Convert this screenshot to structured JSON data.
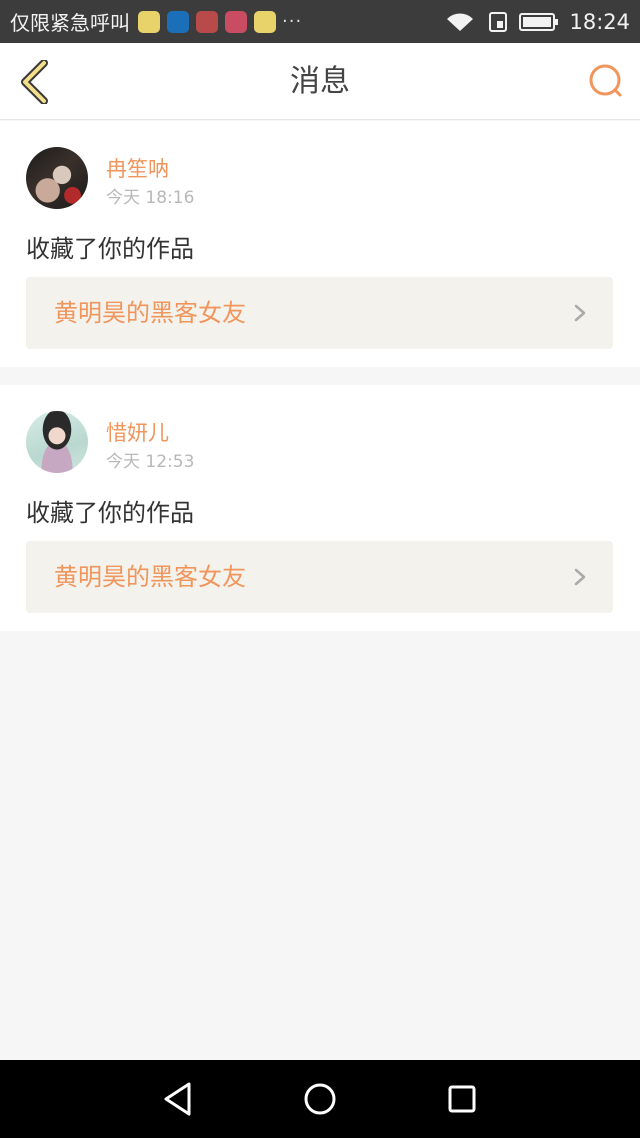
{
  "status_bar": {
    "carrier": "仅限紧急呼叫",
    "time": "18:24",
    "notification_icons": [
      {
        "name": "app-icon-yellow",
        "color": "#e8d36b"
      },
      {
        "name": "app-icon-blue",
        "color": "#1b6fb8"
      },
      {
        "name": "app-icon-red",
        "color": "#b94a4a"
      },
      {
        "name": "app-icon-pink",
        "color": "#c94c63"
      },
      {
        "name": "app-icon-yellow-2",
        "color": "#e8d36b"
      }
    ],
    "more": "···"
  },
  "header": {
    "title": "消息",
    "back_icon": "chevron-left-icon",
    "search_icon": "search-icon"
  },
  "messages": [
    {
      "username": "冉笙呐",
      "time": "今天 18:16",
      "action": "收藏了你的作品",
      "work_title": "黄明昊的黑客女友"
    },
    {
      "username": "惜妍儿",
      "time": "今天 12:53",
      "action": "收藏了你的作品",
      "work_title": "黄明昊的黑客女友"
    }
  ],
  "colors": {
    "accent": "#f0955c",
    "back_icon_fill": "#f5e08a",
    "background": "#f6f6f6"
  }
}
